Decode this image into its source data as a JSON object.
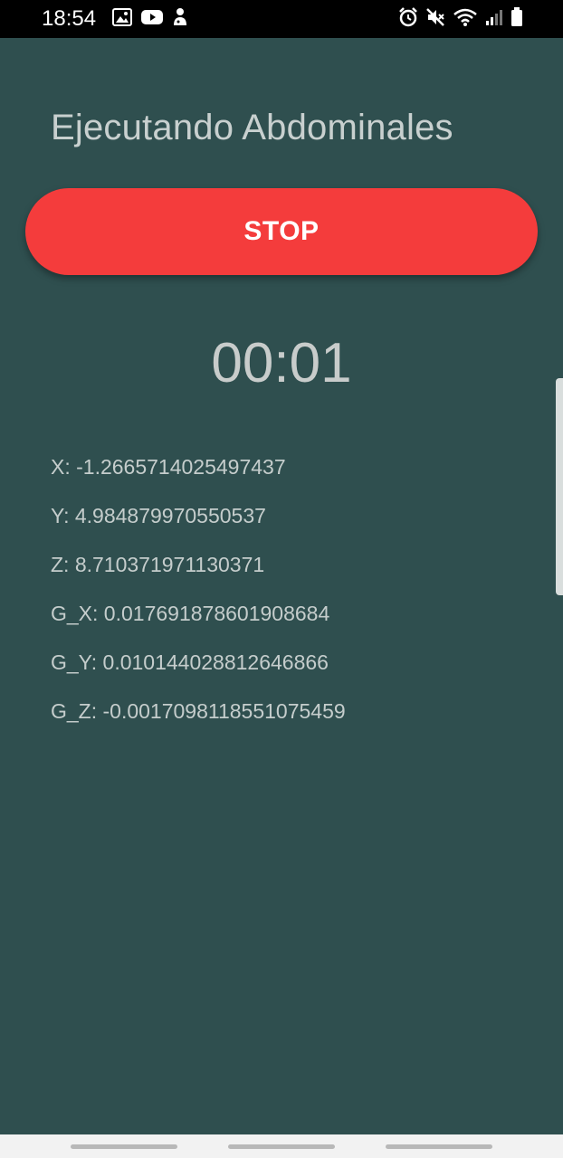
{
  "status_bar": {
    "time": "18:54",
    "left_icons": [
      "gallery-icon",
      "youtube-icon",
      "app-notification-icon"
    ],
    "right_icons": [
      "alarm-icon",
      "mute-icon",
      "wifi-icon",
      "signal-icon",
      "battery-icon"
    ]
  },
  "main": {
    "title": "Ejecutando Abdominales",
    "stop_label": "STOP",
    "timer": "00:01",
    "readings": [
      "X: -1.2665714025497437",
      "Y: 4.984879970550537",
      "Z: 8.710371971130371",
      "G_X: 0.017691878601908684",
      "G_Y: 0.010144028812646866",
      "G_Z: -0.0017098118551075459"
    ]
  },
  "colors": {
    "background": "#2f4f4f",
    "stop_button": "#f43c3c",
    "text": "#c8d0cf"
  }
}
